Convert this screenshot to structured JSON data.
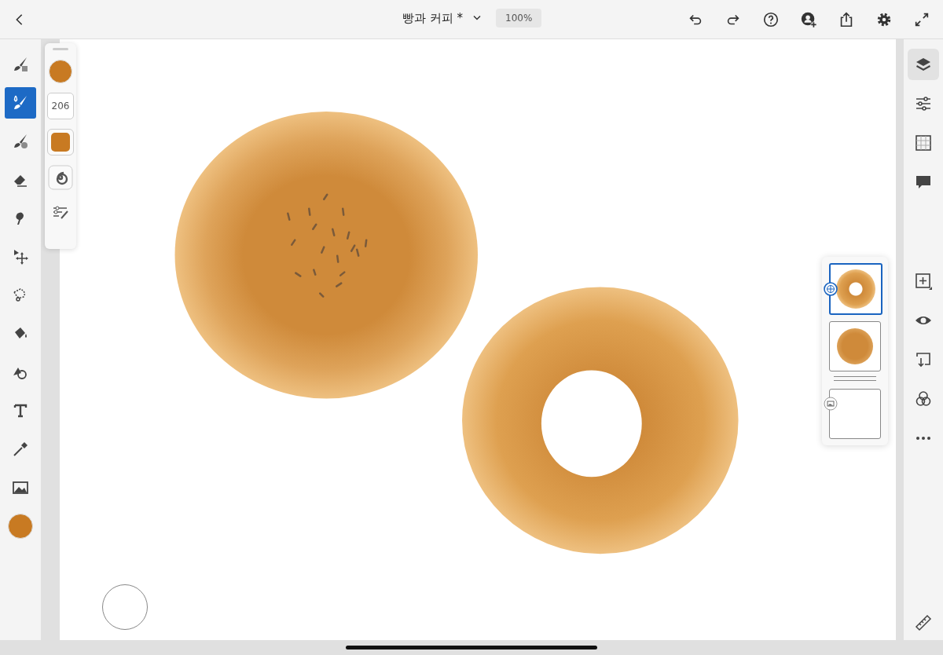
{
  "top_bar": {
    "title": "빵과 커피 *",
    "zoom": "100%"
  },
  "tools": [
    {
      "kind": "pixel",
      "selected": false
    },
    {
      "kind": "live",
      "selected": true
    },
    {
      "kind": "vector",
      "selected": false
    },
    {
      "kind": "eraser",
      "selected": false
    },
    {
      "kind": "smudge",
      "selected": false
    },
    {
      "kind": "move",
      "selected": false
    },
    {
      "kind": "lasso",
      "selected": false
    },
    {
      "kind": "fill",
      "selected": false
    },
    {
      "kind": "shape",
      "selected": false
    },
    {
      "kind": "text",
      "selected": false
    },
    {
      "kind": "eyedropper",
      "selected": false
    },
    {
      "kind": "image",
      "selected": false
    }
  ],
  "brush_panel": {
    "size": "206"
  },
  "layers": [
    {
      "kind": "donut",
      "selected": true
    },
    {
      "kind": "bread",
      "selected": false
    },
    {
      "kind": "blank",
      "selected": false
    }
  ],
  "right_tools": [
    {
      "kind": "layers",
      "selected": true
    },
    {
      "kind": "properties",
      "selected": false
    },
    {
      "kind": "grid",
      "selected": false
    },
    {
      "kind": "comment",
      "selected": false
    }
  ],
  "layer_actions": [
    {
      "kind": "add"
    },
    {
      "kind": "visibility"
    },
    {
      "kind": "import"
    },
    {
      "kind": "blend"
    },
    {
      "kind": "more"
    }
  ]
}
